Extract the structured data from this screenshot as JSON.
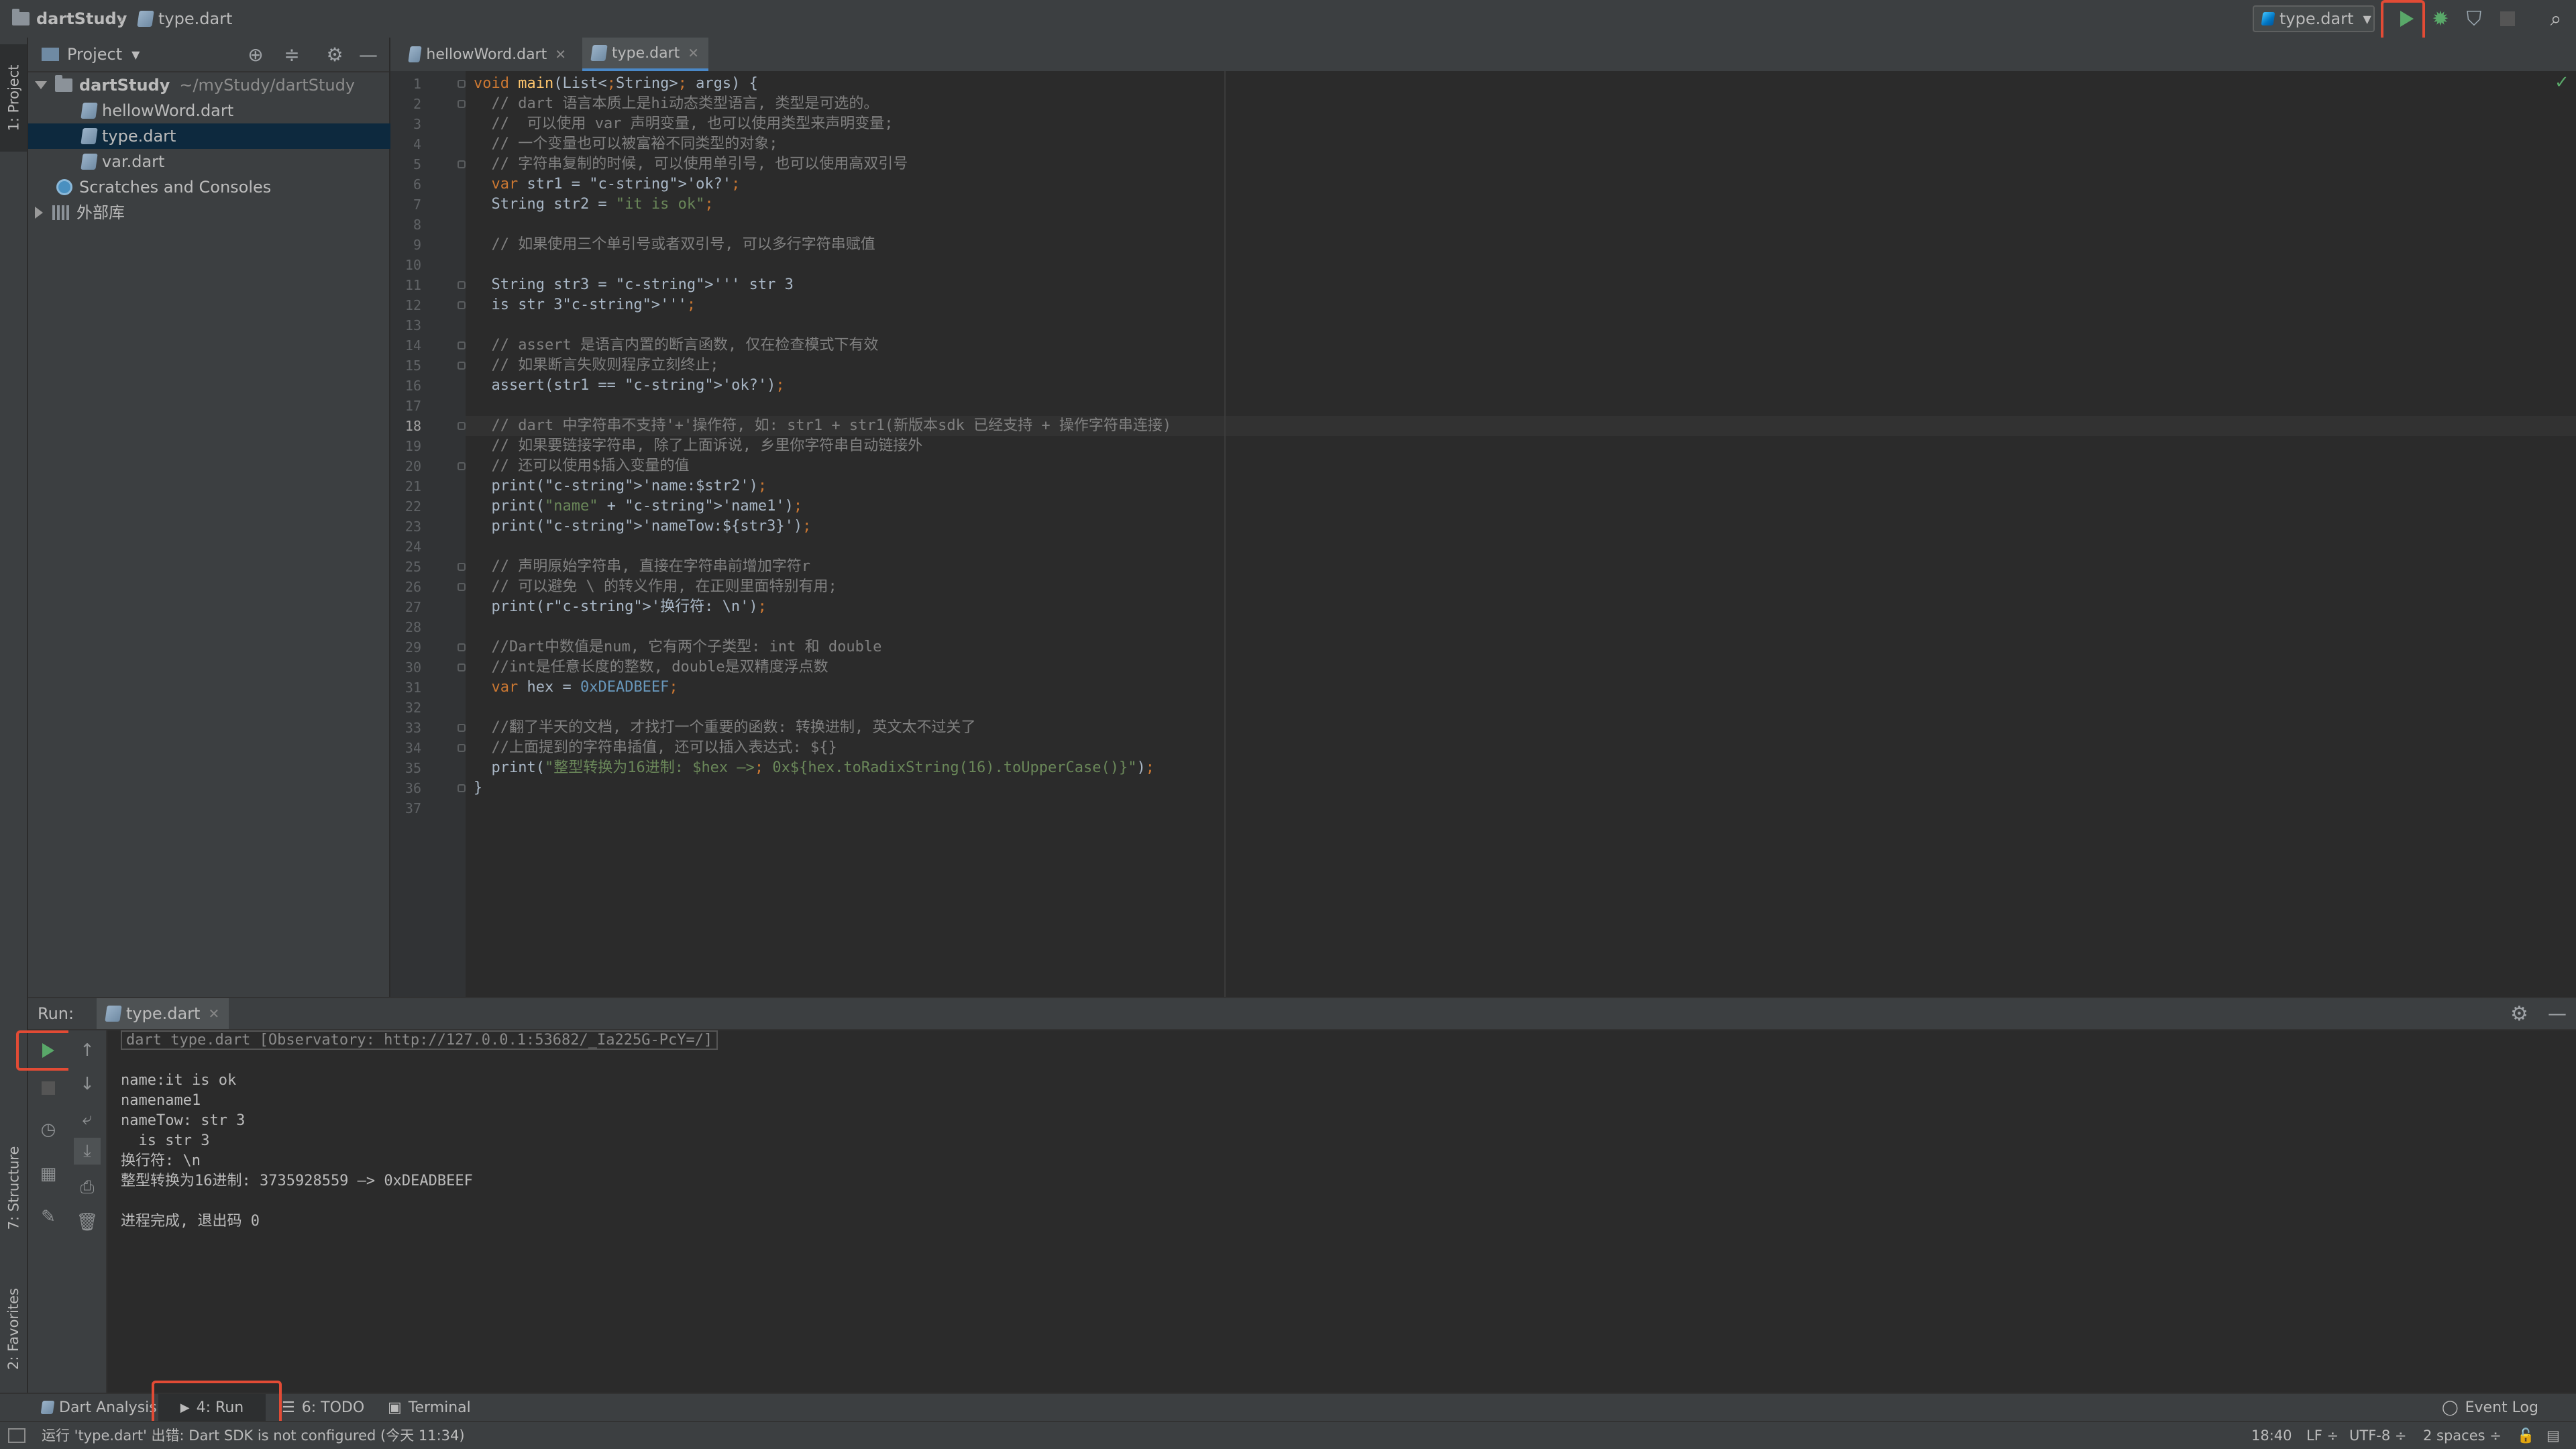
{
  "breadcrumb": {
    "project": "dartStudy",
    "file": "type.dart"
  },
  "run_config": {
    "selected": "type.dart"
  },
  "left_stripe": {
    "project_tab": "1: Project",
    "structure_tab": "7: Structure",
    "favorites_tab": "2: Favorites"
  },
  "project_panel": {
    "view_mode": "Project",
    "tree": [
      {
        "label": "dartStudy",
        "path": "~/myStudy/dartStudy",
        "type": "folder",
        "expanded": true
      },
      {
        "label": "hellowWord.dart",
        "type": "dart-file"
      },
      {
        "label": "type.dart",
        "type": "dart-file",
        "selected": true
      },
      {
        "label": "var.dart",
        "type": "dart-file"
      },
      {
        "label": "Scratches and Consoles",
        "type": "scratches"
      },
      {
        "label": "外部库",
        "type": "library",
        "expanded": false
      }
    ]
  },
  "editor": {
    "tabs": [
      {
        "label": "hellowWord.dart",
        "active": false
      },
      {
        "label": "type.dart",
        "active": true
      }
    ],
    "current_line": 18,
    "lines": [
      "void main(List<String> args) {",
      "  // dart 语言本质上是hi动态类型语言, 类型是可选的。",
      "  //  可以使用 var 声明变量, 也可以使用类型来声明变量;",
      "  // 一个变量也可以被富裕不同类型的对象;",
      "  // 字符串复制的时候, 可以使用单引号, 也可以使用高双引号",
      "  var str1 = 'ok?';",
      "  String str2 = \"it is ok\";",
      "",
      "  // 如果使用三个单引号或者双引号, 可以多行字符串赋值",
      "",
      "  String str3 = ''' str 3",
      "  is str 3''';",
      "",
      "  // assert 是语言内置的断言函数, 仅在检查模式下有效",
      "  // 如果断言失败则程序立刻终止;",
      "  assert(str1 == 'ok?');",
      "",
      "  // dart 中字符串不支持'+'操作符, 如: str1 + str1(新版本sdk 已经支持 + 操作字符串连接)",
      "  // 如果要链接字符串, 除了上面诉说, 乡里你字符串自动链接外",
      "  // 还可以使用$插入变量的值",
      "  print('name:$str2');",
      "  print(\"name\" + 'name1');",
      "  print('nameTow:${str3}');",
      "",
      "  // 声明原始字符串, 直接在字符串前增加字符r",
      "  // 可以避免 \\ 的转义作用, 在正则里面特别有用;",
      "  print(r'换行符: \\n');",
      "",
      "  //Dart中数值是num, 它有两个子类型: int 和 double",
      "  //int是任意长度的整数, double是双精度浮点数",
      "  var hex = 0xDEADBEEF;",
      "",
      "  //翻了半天的文档, 才找打一个重要的函数: 转换进制, 英文太不过关了",
      "  //上面提到的字符串插值, 还可以插入表达式: ${}",
      "  print(\"整型转换为16进制: $hex —> 0x${hex.toRadixString(16).toUpperCase()}\");",
      "}",
      ""
    ]
  },
  "run_panel": {
    "title": "Run:",
    "tab": "type.dart",
    "command": "dart type.dart [Observatory: http://127.0.0.1:53682/_Ia225G-PcY=/]",
    "output": [
      "",
      "name:it is ok",
      "namename1",
      "nameTow: str 3",
      "  is str 3",
      "换行符: \\n",
      "整型转换为16进制: 3735928559 —> 0xDEADBEEF",
      "",
      "进程完成, 退出码 0"
    ]
  },
  "tool_windows": [
    {
      "label": "Dart Analysis",
      "active": false
    },
    {
      "label": "4: Run",
      "active": true
    },
    {
      "label": "6: TODO",
      "active": false
    },
    {
      "label": "Terminal",
      "active": false
    }
  ],
  "event_log": "Event Log",
  "status": {
    "message": "运行 'type.dart' 出错: Dart SDK is not configured (今天 11:34)",
    "position": "18:40",
    "line_separator": "LF ÷",
    "encoding": "UTF-8 ÷",
    "indent": "2 spaces ÷"
  },
  "colors": {
    "run_green": "#59a869",
    "highlight_red": "#e24b35",
    "selection_blue": "#0d293e"
  }
}
